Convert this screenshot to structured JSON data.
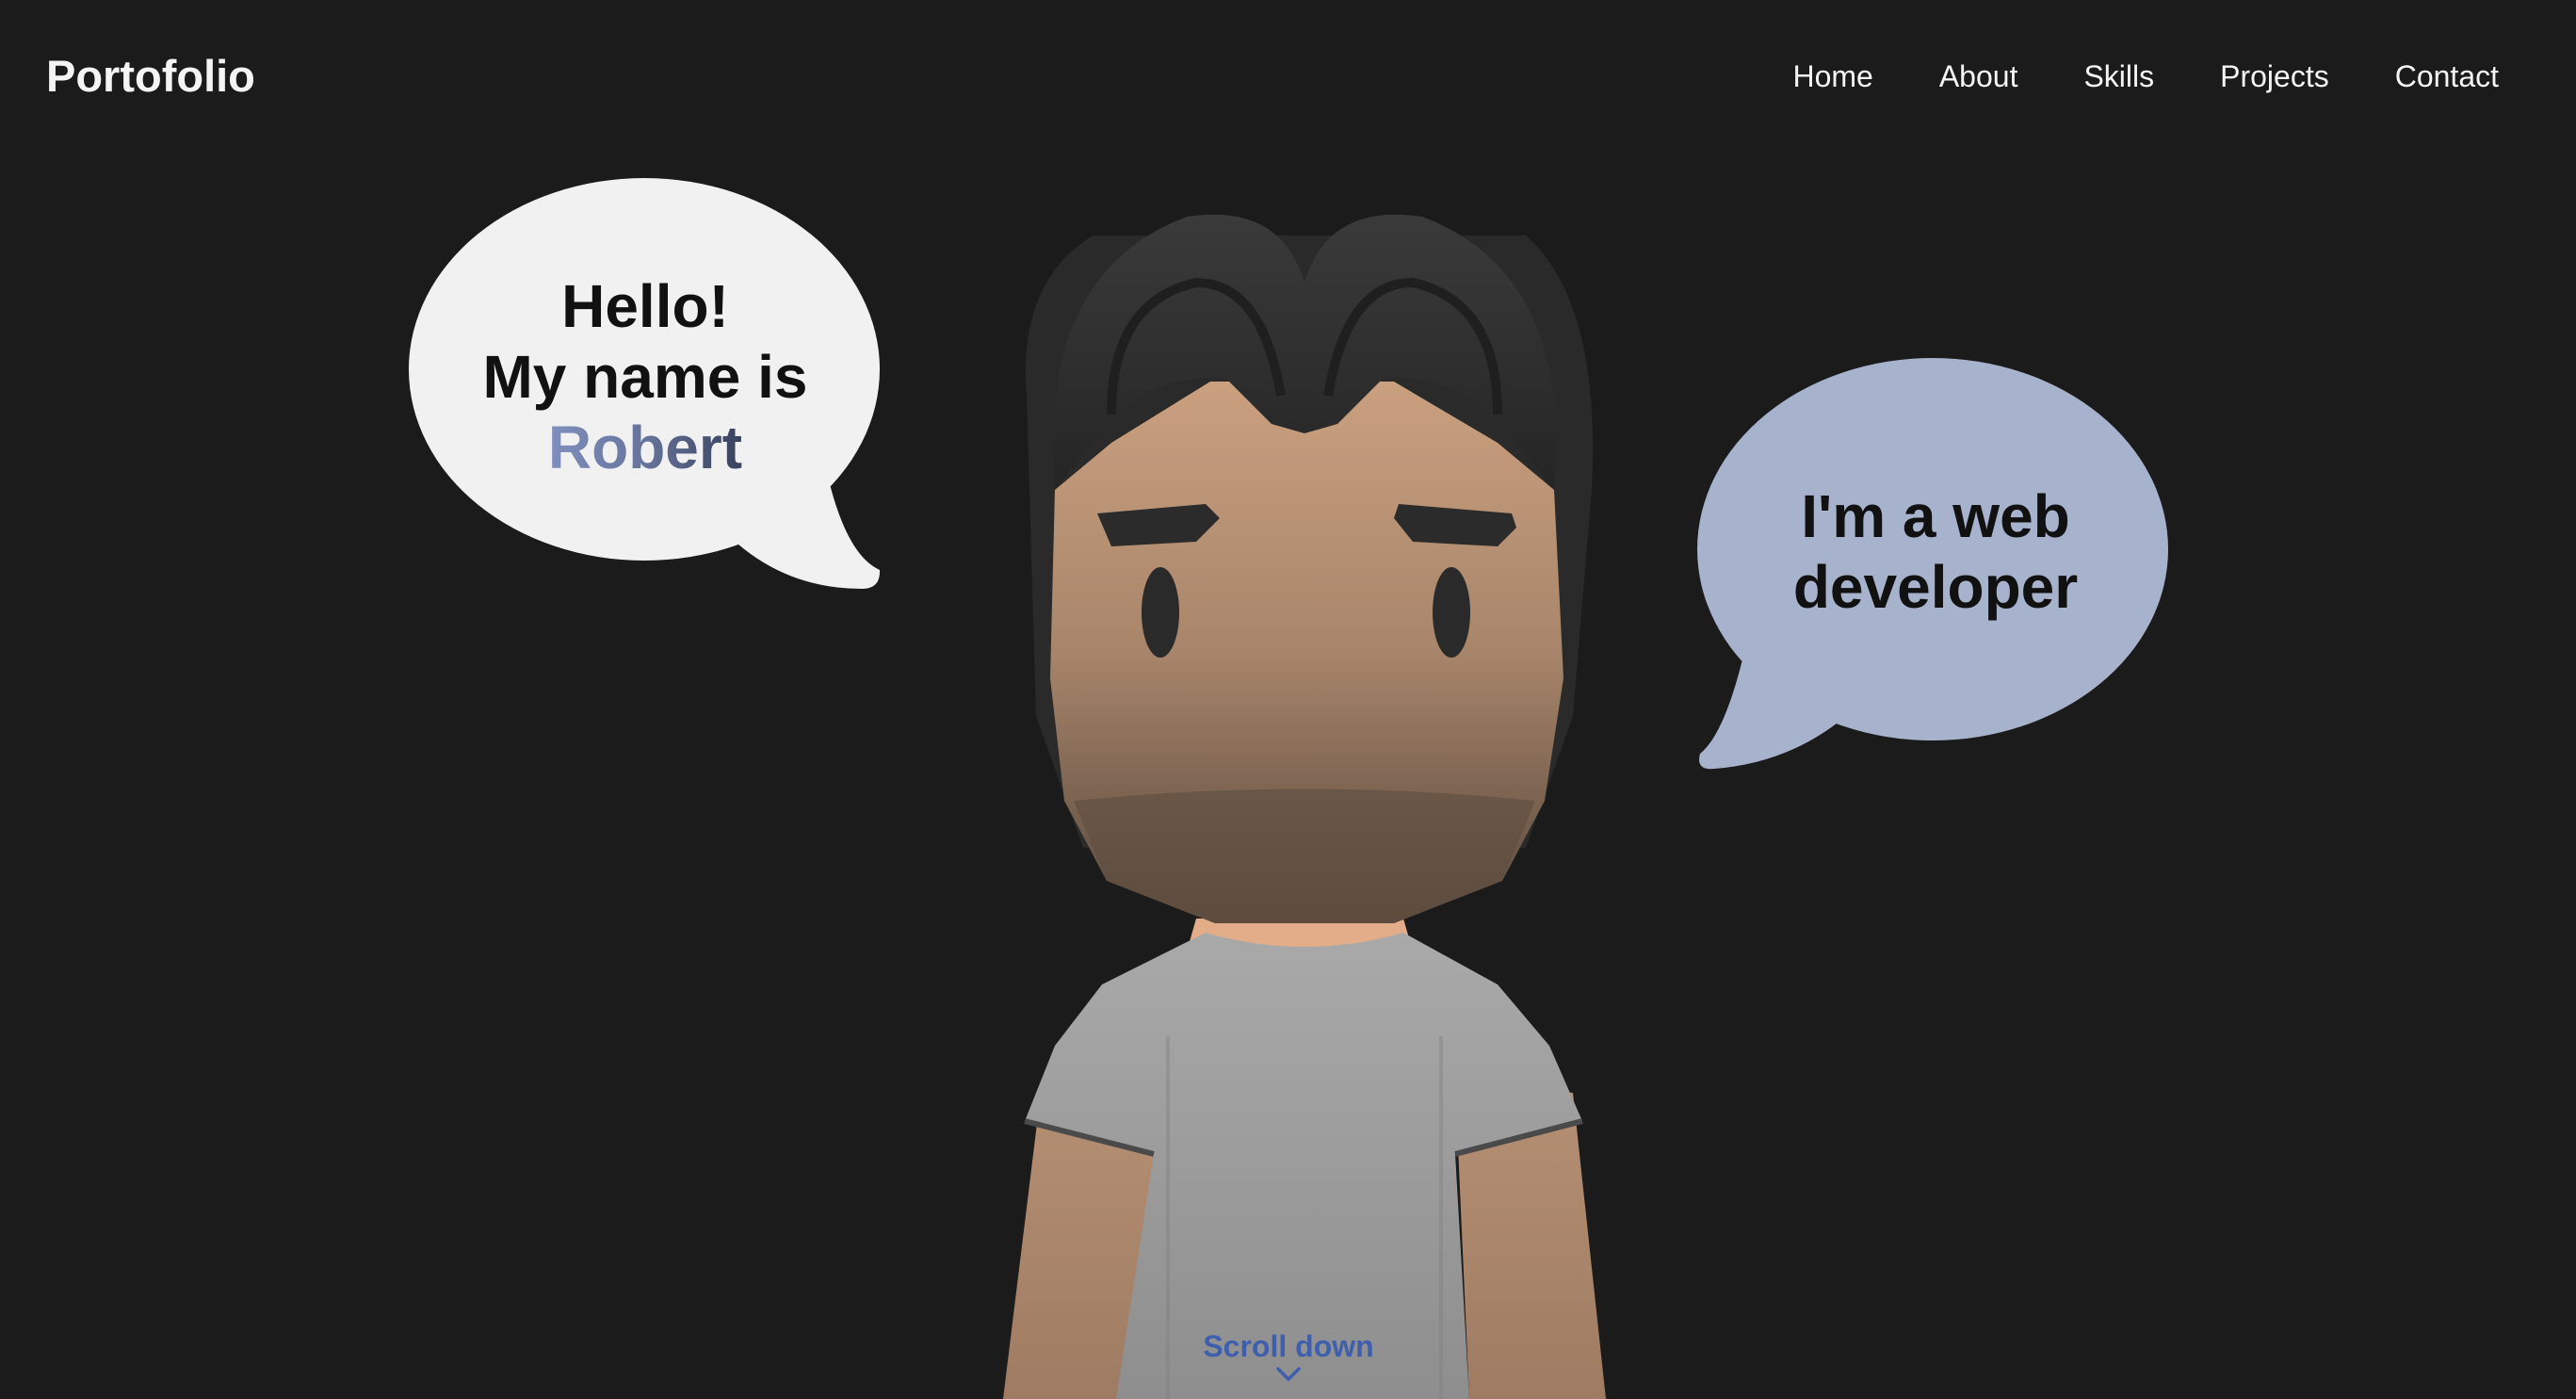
{
  "header": {
    "logo": "Portofolio",
    "nav": [
      "Home",
      "About",
      "Skills",
      "Projects",
      "Contact"
    ]
  },
  "hero": {
    "bubble_left": {
      "line1": "Hello!",
      "line2": "My name is",
      "name": "Robert"
    },
    "bubble_right": {
      "line1": "I'm a web",
      "line2": "developer"
    },
    "scroll_label": "Scroll down"
  },
  "colors": {
    "background": "#1b1b1b",
    "bubble_left": "#f1f1f1",
    "bubble_right": "#a7b2cc",
    "name_gradient_start": "#7f8fbd",
    "name_gradient_end": "#39415c",
    "scroll_text": "#3e5fae"
  },
  "icons": {
    "scroll": "chevron-down-icon"
  }
}
